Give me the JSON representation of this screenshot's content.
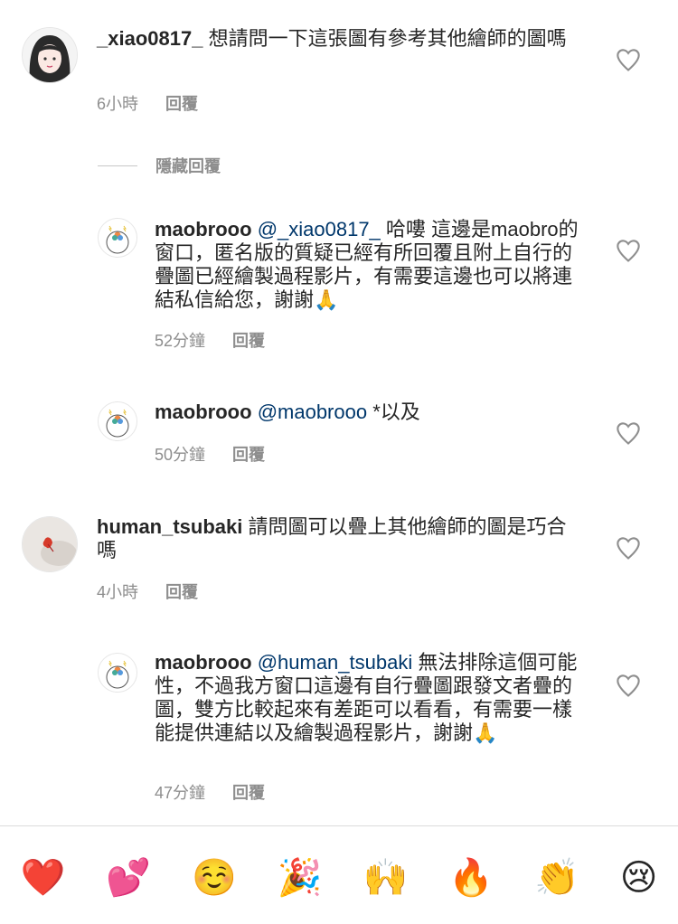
{
  "comments": [
    {
      "username": "_xiao0817_",
      "mention": "",
      "text": "想請問一下這張圖有參考其他繪師的圖嗎",
      "time": "6小時",
      "reply": "回覆"
    },
    {
      "username": "maobrooo",
      "mention": "@_xiao0817_",
      "text": "哈嘍 這邊是maobro的窗口，匿名版的質疑已經有所回覆且附上自行的疊圖已經繪製過程影片，有需要這邊也可以將連結私信給您，謝謝🙏",
      "time": "52分鐘",
      "reply": "回覆"
    },
    {
      "username": "maobrooo",
      "mention": "@maobrooo",
      "text": "*以及",
      "time": "50分鐘",
      "reply": "回覆"
    },
    {
      "username": "human_tsubaki",
      "mention": "",
      "text": "請問圖可以疊上其他繪師的圖是巧合嗎",
      "time": "4小時",
      "reply": "回覆"
    },
    {
      "username": "maobrooo",
      "mention": "@human_tsubaki",
      "text": "無法排除這個可能性，不過我方窗口這邊有自行疊圖跟發文者疊的圖，雙方比較起來有差距可以看看，有需要一樣能提供連結以及繪製過程影片，謝謝🙏",
      "time": "47分鐘",
      "reply": "回覆"
    }
  ],
  "hide_replies": "隱藏回覆",
  "emoji_bar": [
    "❤️",
    "💕",
    "☺️",
    "🎉",
    "🙌",
    "🔥",
    "👏",
    "😢"
  ],
  "colors": {
    "mention": "#00376b",
    "meta": "#8e8e8e",
    "text": "#262626"
  }
}
